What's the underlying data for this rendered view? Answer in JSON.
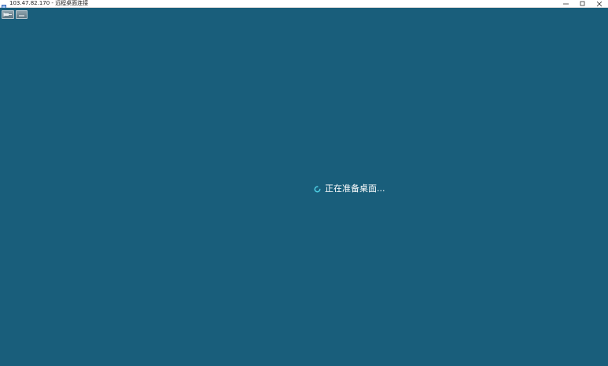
{
  "window": {
    "title": "103.47.82.170 - 远程桌面连接",
    "controls": {
      "minimize_icon": "minimize-icon",
      "maximize_icon": "maximize-icon",
      "close_icon": "close-icon"
    }
  },
  "connection_bar": {
    "pin_icon": "pin-icon",
    "minimize_icon": "minimize-icon"
  },
  "status": {
    "text": "正在准备桌面...",
    "spinner_icon": "spinner-icon"
  },
  "colors": {
    "desktop_background": "#195e7b",
    "titlebar_background": "#ffffff",
    "status_text": "#ffffff",
    "spinner": "#4fd1e6"
  }
}
